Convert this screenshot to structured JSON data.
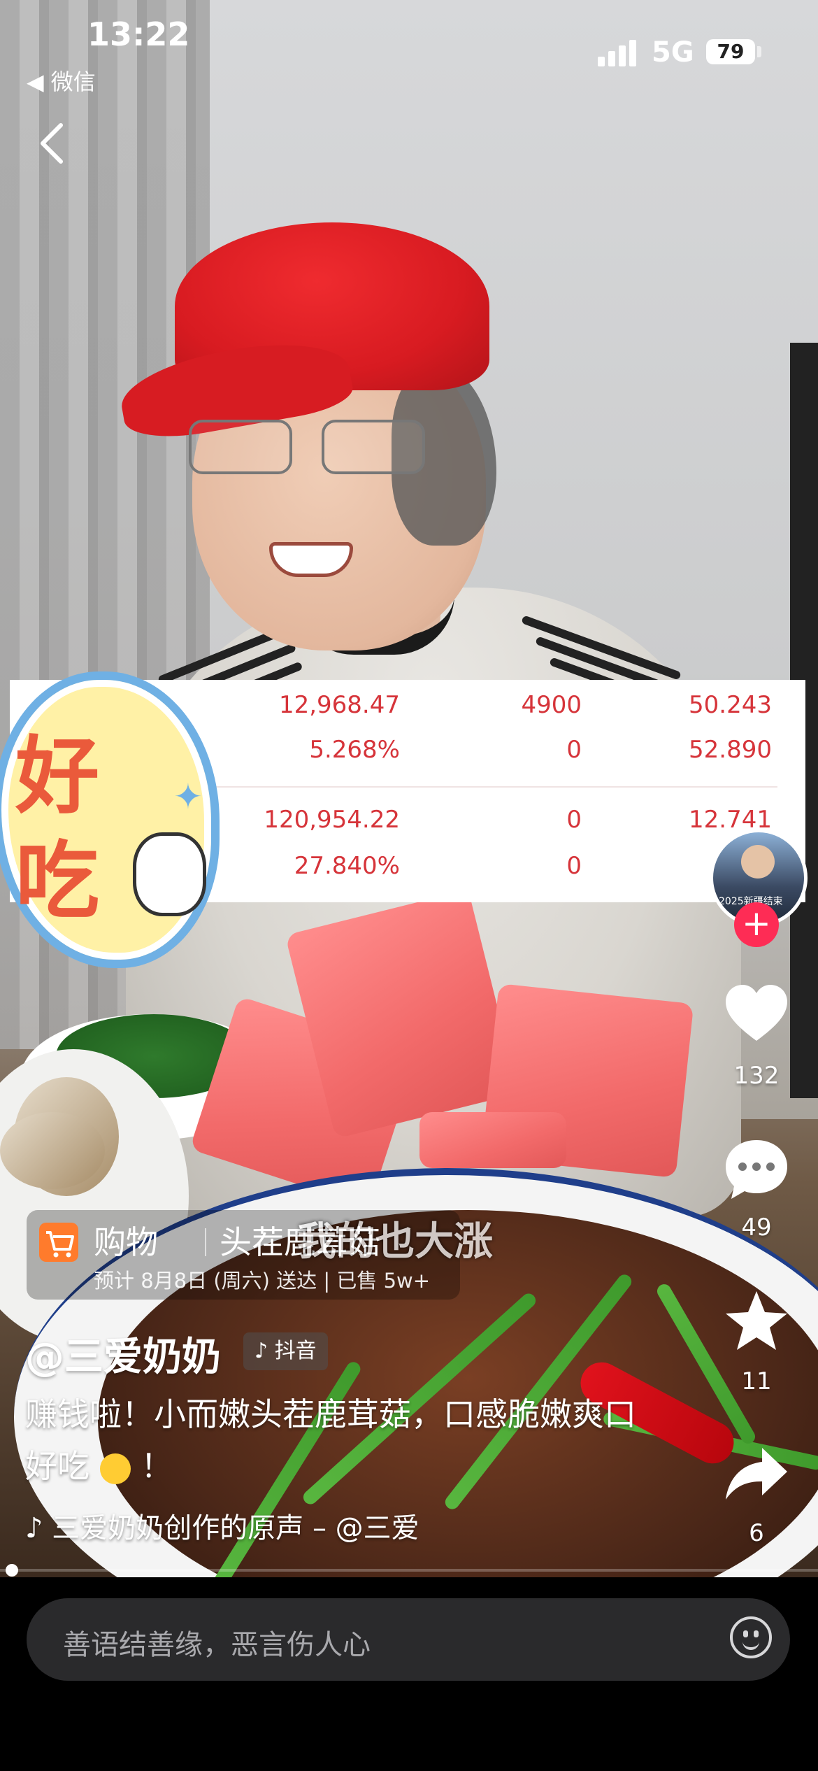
{
  "status_bar": {
    "time": "13:22",
    "back_app": "◀ 微信",
    "network": "5G",
    "battery": "79"
  },
  "data_overlay": {
    "rows": [
      {
        "col1": "12,968.47",
        "col2": "4900",
        "col3": "50.243"
      },
      {
        "col1": "5.268%",
        "col2": "0",
        "col3": "52.890"
      },
      {
        "col1": "120,954.22",
        "col2": "0",
        "col3": "12.741"
      },
      {
        "col1": "27.840%",
        "col2": "0",
        "col3": "1("
      }
    ]
  },
  "sticker": {
    "line1": "好",
    "line2": "吃"
  },
  "right_rail": {
    "avatar_caption": "2025新疆结束",
    "follow": "+",
    "likes": "132",
    "comments": "49",
    "favorites": "11",
    "shares": "6"
  },
  "shopping": {
    "label": "购物",
    "product": "头茬鹿茸菇",
    "subtitle": "预计 8月8日 (周六) 送达 | 已售 5w+"
  },
  "video_subtitle": "我的也大涨",
  "author": "@三爱奶奶",
  "platform_badge": "抖音",
  "description": "赚钱啦！小而嫩头茬鹿茸菇，口感脆嫩爽口好吃",
  "description_tail": "！",
  "music": "♪ 三爱奶奶创作的原声 – @三爱",
  "comment_placeholder": "善语结善缘，恶言伤人心",
  "colors": {
    "accent_red": "#fe2c55",
    "data_red": "#d6343a",
    "shop_orange": "#ff7b2c"
  }
}
